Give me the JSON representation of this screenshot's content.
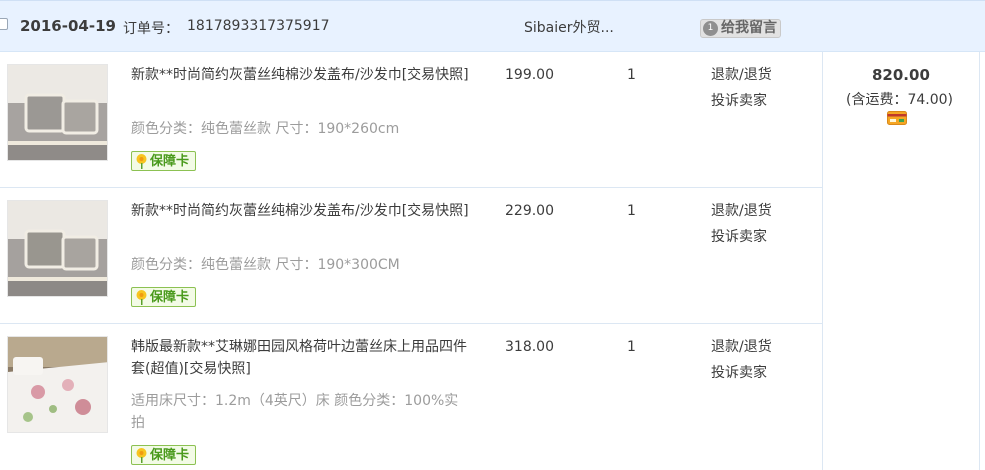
{
  "header": {
    "date": "2016-04-19",
    "order_label": "订单号：",
    "order_number": "1817893317375917",
    "shop": "Sibaier外贸...",
    "message_button": "给我留言",
    "message_icon_text": "1"
  },
  "summary": {
    "total": "820.00",
    "shipping": "(含运费：74.00)",
    "payment_icon": "card-icon"
  },
  "items": [
    {
      "title": "新款**时尚简约灰蕾丝纯棉沙发盖布/沙发巾[交易快照]",
      "sku": "颜色分类：纯色蕾丝款  尺寸：190*260cm",
      "badge": "保障卡",
      "price": "199.00",
      "qty": "1",
      "refund": "退款/退货",
      "complain": "投诉卖家"
    },
    {
      "title": "新款**时尚简约灰蕾丝纯棉沙发盖布/沙发巾[交易快照]",
      "sku": "颜色分类：纯色蕾丝款  尺寸：190*300CM",
      "badge": "保障卡",
      "price": "229.00",
      "qty": "1",
      "refund": "退款/退货",
      "complain": "投诉卖家"
    },
    {
      "title": "韩版最新款**艾琳娜田园风格荷叶边蕾丝床上用品四件套(超值)[交易快照]",
      "sku": "适用床尺寸：1.2m（4英尺）床  颜色分类：100%实拍",
      "badge": "保障卡",
      "price": "318.00",
      "qty": "1",
      "refund": "退款/退货",
      "complain": "投诉卖家"
    }
  ],
  "colors": {
    "header_bg": "#e8f2ff",
    "divider": "#dce7f3",
    "badge_green": "#4a9a1c"
  }
}
